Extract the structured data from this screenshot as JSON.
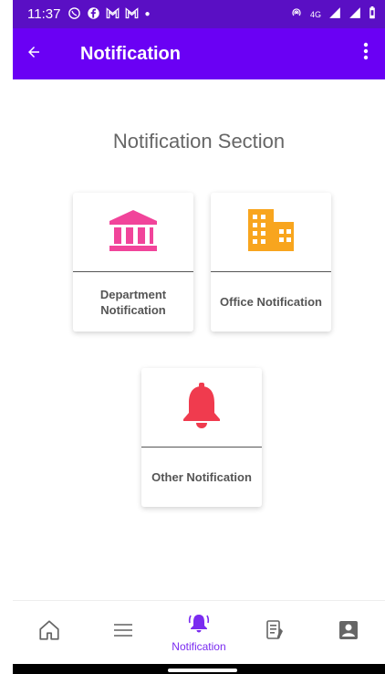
{
  "status_bar": {
    "time": "11:37",
    "icons": [
      "whatsapp-icon",
      "facebook-icon",
      "gmail-icon",
      "gmail-icon",
      "dot"
    ],
    "right": [
      "hotspot-icon",
      "4G",
      "signal-icon",
      "signal-icon",
      "battery-icon"
    ],
    "network_label": "4G"
  },
  "appbar": {
    "title": "Notification",
    "back_icon": "arrow-left-icon",
    "more_icon": "more-vert-icon"
  },
  "section_title": "Notification Section",
  "cards": [
    {
      "label": "Department Notification",
      "icon": "bank-icon",
      "color": "#f1449a"
    },
    {
      "label": "Office Notification",
      "icon": "office-building-icon",
      "color": "#f8a51e"
    },
    {
      "label": "Other Notification",
      "icon": "bell-icon",
      "color": "#f03b4e"
    }
  ],
  "bottom_nav": {
    "items": [
      {
        "icon": "home-icon"
      },
      {
        "icon": "menu-icon"
      },
      {
        "icon": "notification-bell-icon",
        "label": "Notification",
        "active": true
      },
      {
        "icon": "notes-icon"
      },
      {
        "icon": "profile-icon"
      }
    ],
    "active_color": "#7a2bf0"
  },
  "colors": {
    "status_bar": "#5a0fc4",
    "app_bar": "#6a00f4"
  }
}
